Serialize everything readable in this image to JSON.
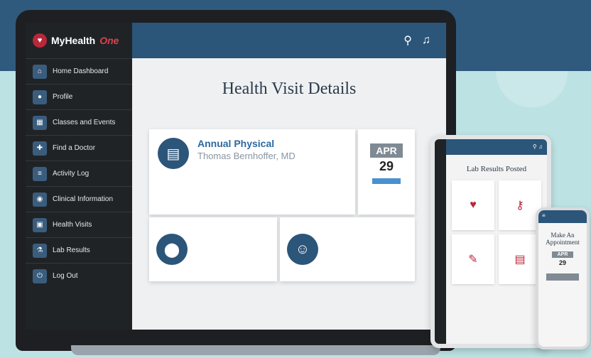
{
  "app": {
    "logo_text": "MyHealth",
    "logo_accent": "One"
  },
  "sidebar": {
    "items": [
      {
        "label": "Home Dashboard",
        "icon": "home-icon"
      },
      {
        "label": "Profile",
        "icon": "profile-icon"
      },
      {
        "label": "Classes and Events",
        "icon": "calendar-icon"
      },
      {
        "label": "Find a Doctor",
        "icon": "doctor-icon"
      },
      {
        "label": "Activity Log",
        "icon": "activity-icon"
      },
      {
        "label": "Clinical Information",
        "icon": "clinical-icon"
      },
      {
        "label": "Health Visits",
        "icon": "visits-icon"
      },
      {
        "label": "Lab Results",
        "icon": "lab-icon"
      },
      {
        "label": "Log Out",
        "icon": "logout-icon"
      }
    ]
  },
  "header": {
    "search_icon": "search-icon",
    "bell_icon": "bell-icon"
  },
  "main": {
    "page_title": "Health Visit Details",
    "visit": {
      "title": "Annual Physical",
      "doctor": "Thomas Bernhoffer, MD"
    },
    "date": {
      "month": "APR",
      "day": "29"
    }
  },
  "tablet": {
    "title": "Lab Results Posted"
  },
  "phone": {
    "title": "Make An Appointment",
    "month": "APR",
    "day": "29"
  },
  "colors": {
    "brand_blue": "#2c557a",
    "brand_red": "#b8283a",
    "sidebar_bg": "#202326"
  }
}
